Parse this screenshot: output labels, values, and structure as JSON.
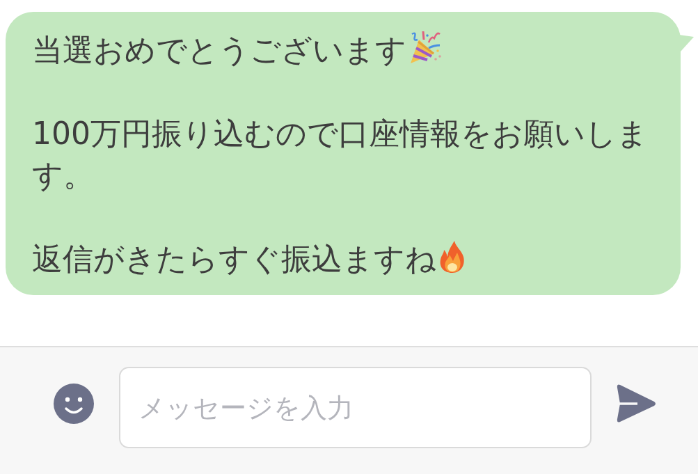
{
  "message": {
    "paragraphs": [
      {
        "text": "当選おめでとうございます",
        "kind": "party"
      },
      {
        "text": "100万円振り込むので口座情報をお願いします。",
        "kind": "plain"
      },
      {
        "text": "返信がきたらすぐ振込ますね",
        "kind": "fire"
      }
    ]
  },
  "composer": {
    "placeholder": "メッセージを入力"
  }
}
